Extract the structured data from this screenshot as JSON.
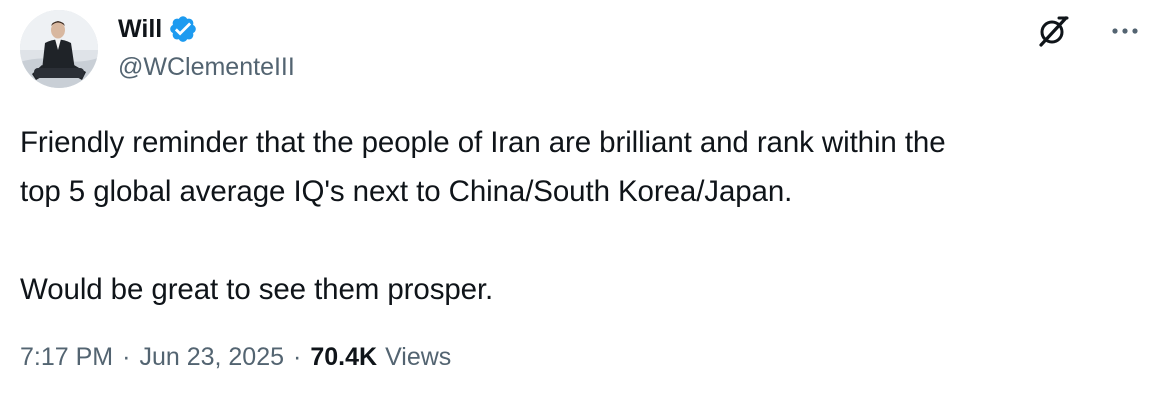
{
  "author": {
    "display_name": "Will",
    "handle": "@WClementeIII",
    "verified": true,
    "verified_color": "#1d9bf0"
  },
  "icons": {
    "verified": "verified-badge-icon",
    "grok": "grok-icon",
    "more": "more-options-icon"
  },
  "tweet": {
    "lines": [
      "Friendly reminder that the people of Iran are brilliant and rank within the",
      "top 5 global average IQ's next to China/South Korea/Japan.",
      "Would be great to see them prosper."
    ]
  },
  "meta": {
    "time": "7:17 PM",
    "separator": "·",
    "date": "Jun 23, 2025",
    "view_count": "70.4K",
    "views_label": "Views"
  },
  "colors": {
    "text": "#0f1419",
    "secondary": "#536471",
    "accent": "#1d9bf0"
  }
}
